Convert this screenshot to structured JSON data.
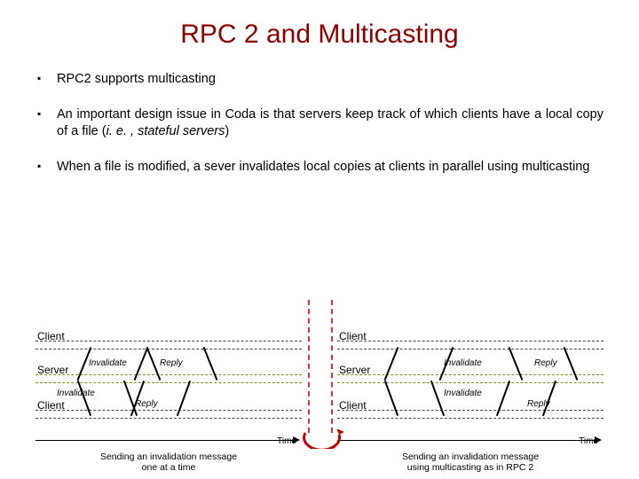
{
  "title": "RPC 2 and Multicasting",
  "bullets": [
    {
      "text": "RPC2 supports multicasting"
    },
    {
      "text": "An important design issue in Coda is that servers keep track of which clients have a local copy of a file (",
      "italic": "i. e. , stateful servers",
      "after": ")"
    },
    {
      "text": "When a file is modified, a sever invalidates local copies at clients in parallel using multicasting"
    }
  ],
  "diagram": {
    "lanes": {
      "client": "Client",
      "server": "Server"
    },
    "messages": {
      "invalidate": "Invalidate",
      "reply": "Reply"
    },
    "time": "Time",
    "captions": {
      "left_line1": "Sending an invalidation message",
      "left_line2": "one at a time",
      "right_line1": "Sending an invalidation message",
      "right_line2": "using multicasting as in RPC 2"
    }
  }
}
